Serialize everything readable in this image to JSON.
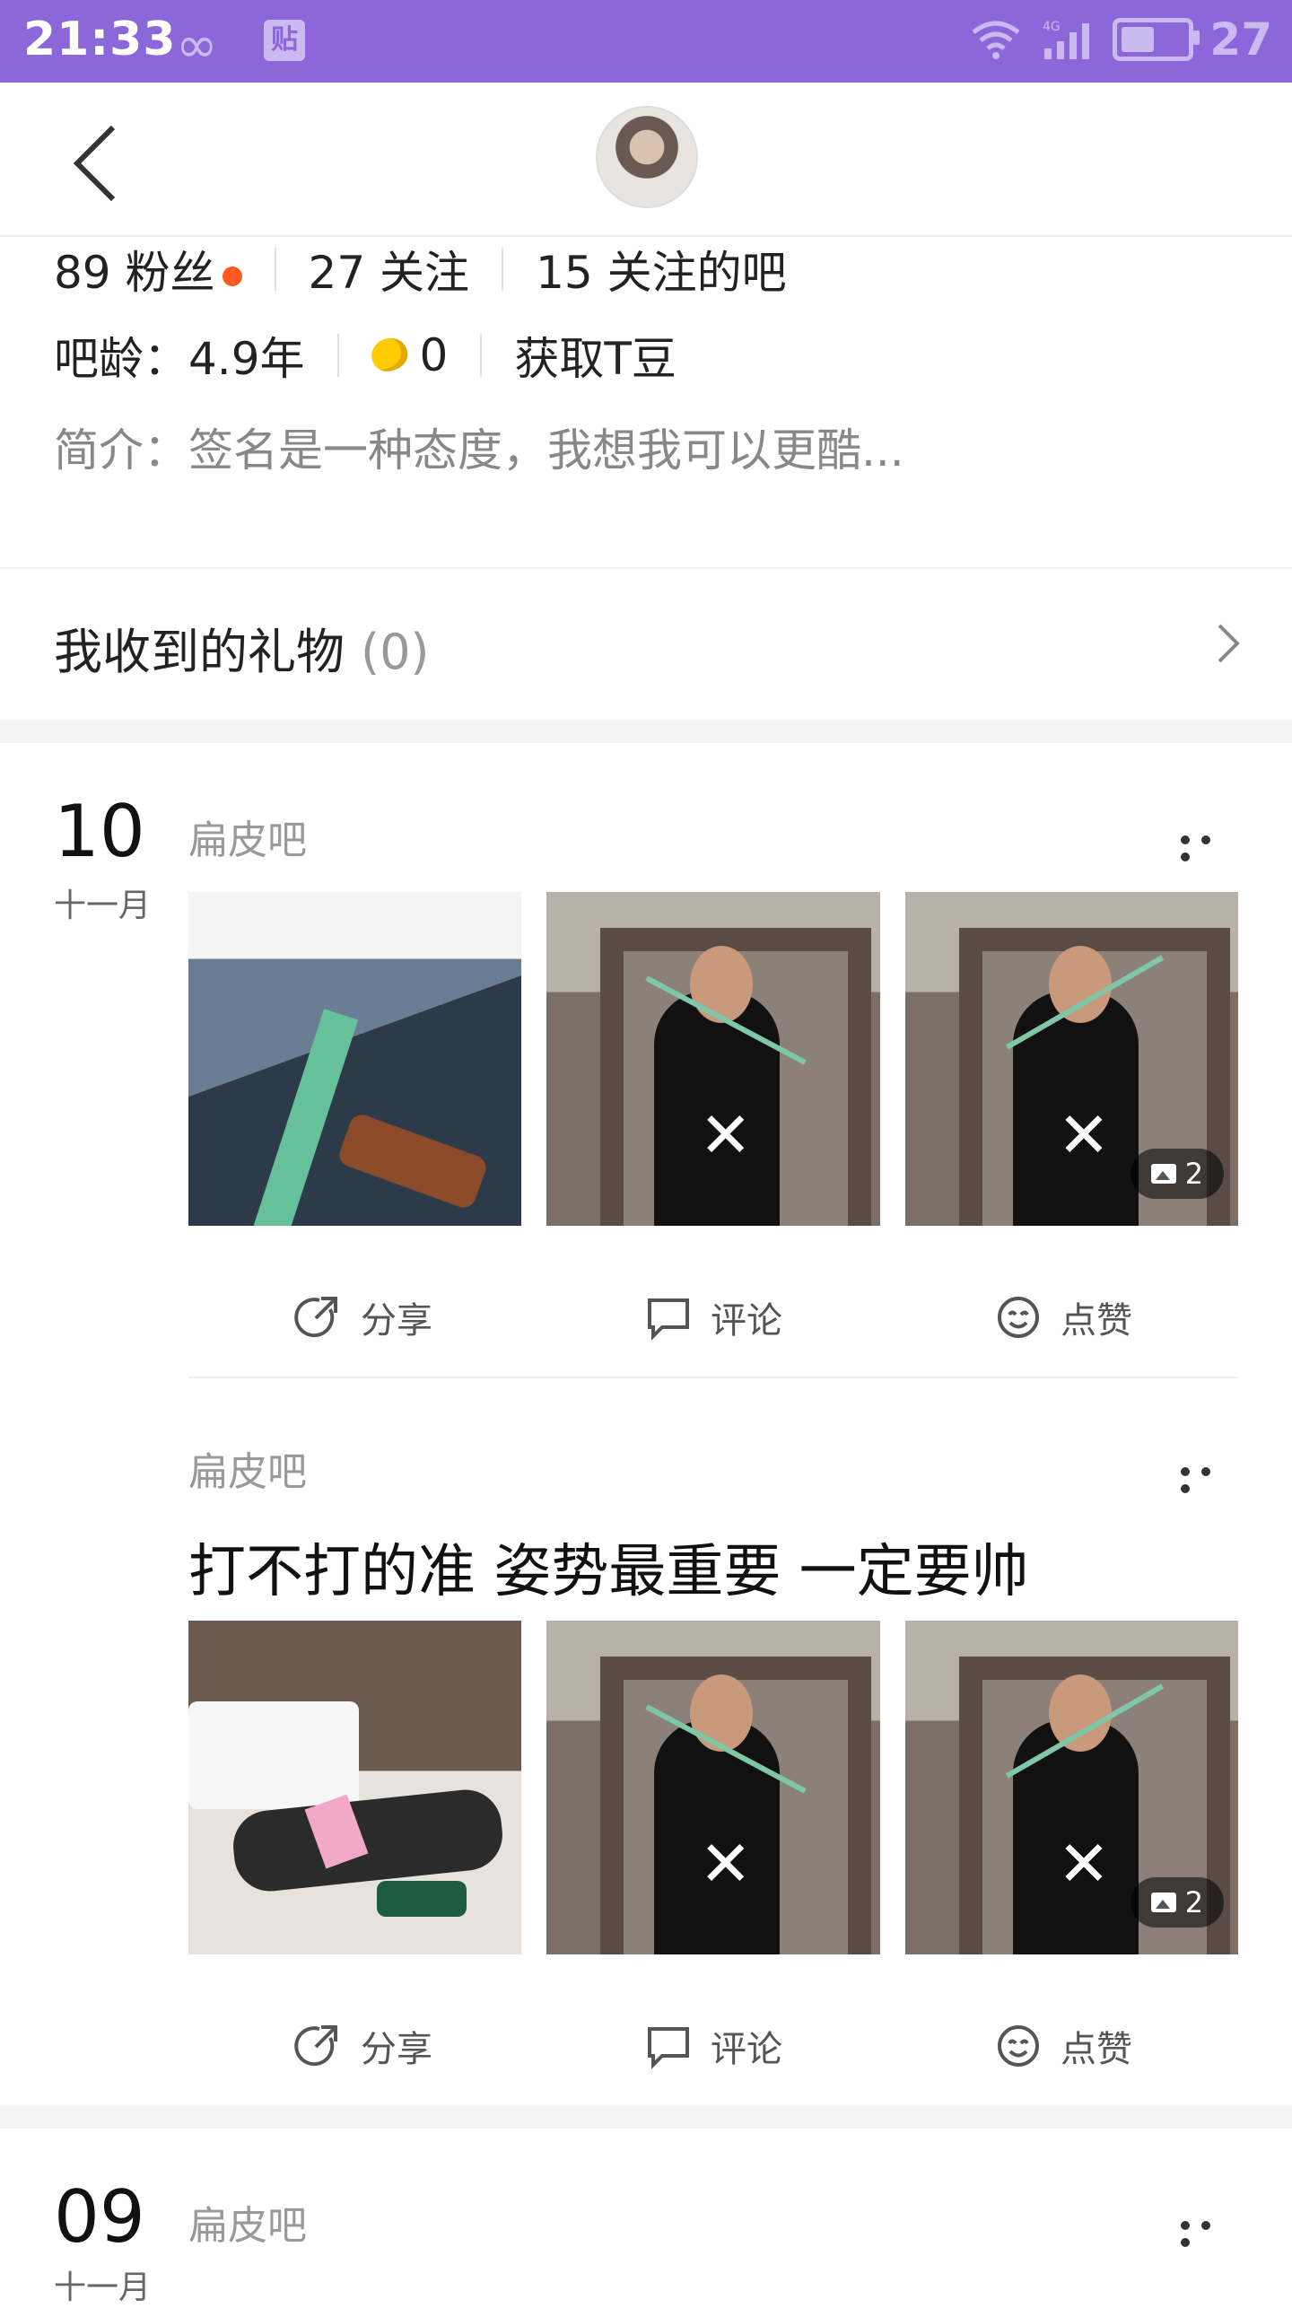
{
  "status_bar": {
    "time": "21:33",
    "infinity_icon": "infinity-icon",
    "tie_glyph": "贴",
    "battery_level": "27"
  },
  "header": {
    "back_icon": "chevron-left-icon",
    "avatar_icon": "user-avatar"
  },
  "stats": {
    "fans": "89 粉丝",
    "following": "27 关注",
    "followed_forums": "15 关注的吧"
  },
  "profile": {
    "bar_age": "吧龄：4.9年",
    "t_beans": "0",
    "get_beans": "获取T豆",
    "intro": "简介：签名是一种态度，我想我可以更酷..."
  },
  "gifts": {
    "label": "我收到的礼物",
    "count": "(0)"
  },
  "posts": [
    {
      "day": "10",
      "month": "十一月",
      "forum": "扁皮吧",
      "title": "",
      "image_count": "2",
      "actions": {
        "share": "分享",
        "comment": "评论",
        "like": "点赞"
      }
    },
    {
      "forum": "扁皮吧",
      "title": "打不打的准 姿势最重要 一定要帅",
      "image_count": "2",
      "actions": {
        "share": "分享",
        "comment": "评论",
        "like": "点赞"
      }
    },
    {
      "day": "09",
      "month": "十一月",
      "forum": "扁皮吧"
    }
  ],
  "colors": {
    "status_bar": "#8b67d9",
    "accent_dot": "#ff5a1f"
  }
}
